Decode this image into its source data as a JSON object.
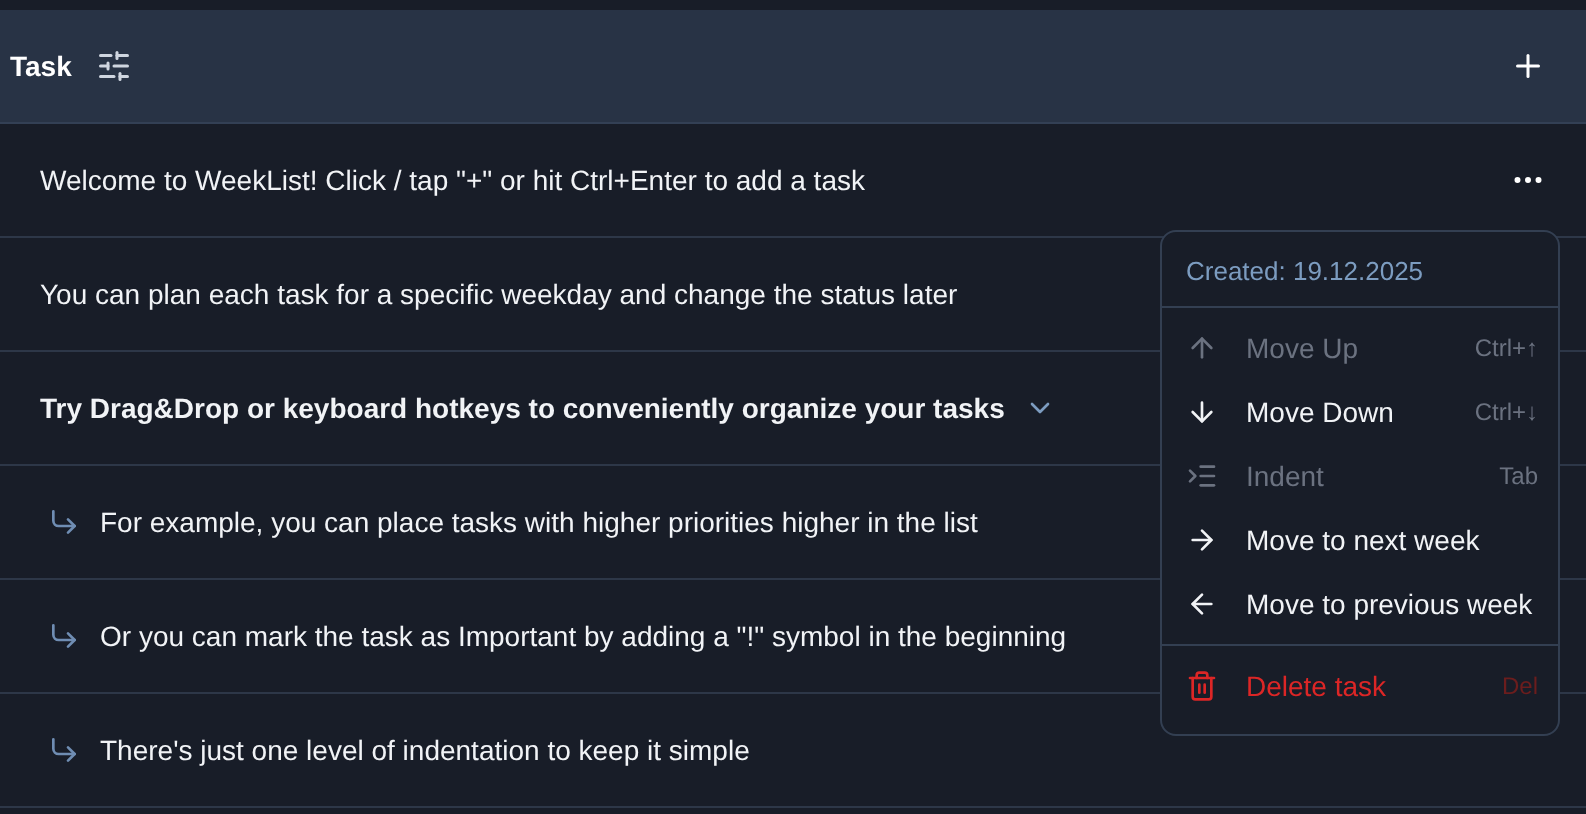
{
  "header": {
    "title": "Task"
  },
  "tasks": [
    {
      "text": "Welcome to WeekList! Click / tap \"+\" or hit Ctrl+Enter to add a task",
      "menu": {
        "created": "Created: 19.12.2025",
        "items": [
          {
            "kind": "up",
            "label": "Move Up",
            "shortcut": "Ctrl+↑",
            "disabled": true
          },
          {
            "kind": "down",
            "label": "Move Down",
            "shortcut": "Ctrl+↓",
            "disabled": false
          },
          {
            "kind": "indent",
            "label": "Indent",
            "shortcut": "Tab",
            "disabled": true
          },
          {
            "kind": "next",
            "label": "Move to next week",
            "disabled": false
          },
          {
            "kind": "prev",
            "label": "Move to previous week",
            "disabled": false
          },
          {
            "kind": "delete",
            "label": "Delete task",
            "shortcut": "Del",
            "disabled": false
          }
        ]
      }
    },
    {
      "text": "You can plan each task for a specific weekday and change the status later"
    },
    {
      "text": "Try Drag&Drop or keyboard hotkeys to conveniently organize your tasks",
      "expanded": true,
      "children": [
        {
          "text": "For example, you can place tasks with higher priorities higher in the list"
        },
        {
          "text": "Or you can mark the task as Important by adding a \"!\" symbol in the beginning"
        },
        {
          "text": "There's just one level of indentation to keep it simple"
        }
      ]
    }
  ]
}
